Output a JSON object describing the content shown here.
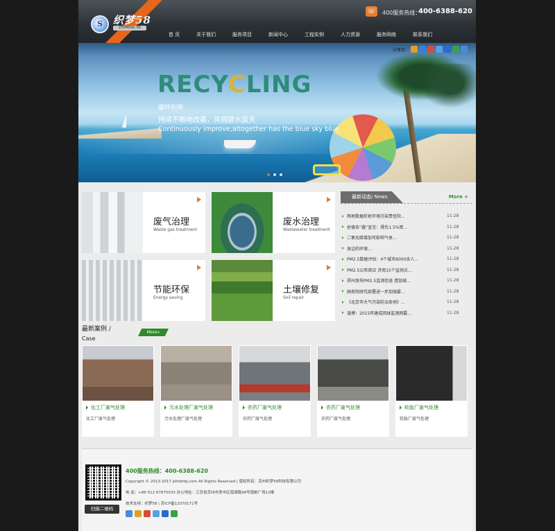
{
  "header": {
    "logo_text": "织梦58",
    "logo_badge": "S",
    "logo_sub": "ZHIMENG 58",
    "hotline_label": "400服务热线：",
    "hotline_number": "400-6388-620"
  },
  "nav": [
    "首 页",
    "关于我们",
    "服务项目",
    "新闻中心",
    "工程实例",
    "人力资源",
    "服务网络",
    "联系我们"
  ],
  "banner": {
    "share_label": "分享到:",
    "headline_a": "RECY",
    "headline_b": "C",
    "headline_c": "LING",
    "cn_line1": "循环利用",
    "cn_line2": "持续不断地改善，共拥碧水蓝天",
    "en_line": "Continuously improve,altogether has the blue sky blue"
  },
  "services": [
    {
      "title": "废气治理",
      "subtitle": "Waste gas treatment"
    },
    {
      "title": "废水治理",
      "subtitle": "Wastewater treatment"
    },
    {
      "title": "节能环保",
      "subtitle": "Energy saving"
    },
    {
      "title": "土壤修复",
      "subtitle": "Soil repair"
    }
  ],
  "news": {
    "title": "最新动态/ News",
    "more": "More +",
    "items": [
      {
        "title": "两地数据折射环境污染责任险...",
        "date": "11-28"
      },
      {
        "title": "佐德去“霾”宣言：得负1.5%密...",
        "date": "11-28"
      },
      {
        "title": "二氧化碳增加可影响气体...",
        "date": "11-28"
      },
      {
        "title": "身边的环保...",
        "date": "11-28"
      },
      {
        "title": "PM2.5数据评估：4个城市8000余人...",
        "date": "11-28"
      },
      {
        "title": "PM2.5公布首日 济南15个监测点...",
        "date": "11-28"
      },
      {
        "title": "郑州发布PM2.5监测信息 借加坡...",
        "date": "11-28"
      },
      {
        "title": "国务院研究部署进一步加强雾...",
        "date": "11-28"
      },
      {
        "title": "《北京市大气污染防治条例》...",
        "date": "11-28"
      },
      {
        "title": "淄博：2015年建成回球监测网要...",
        "date": "11-28"
      }
    ]
  },
  "cases": {
    "title": "最新案例 /",
    "title_en": "Case",
    "more": "More»",
    "items": [
      {
        "caption": "化工厂废气处理",
        "desc": "化工厂废气处理"
      },
      {
        "caption": "污水处理厂废气处理",
        "desc": "污水处理厂废气处理"
      },
      {
        "caption": "农药厂废气处理",
        "desc": "农药厂废气处理"
      },
      {
        "caption": "农药厂废气处理",
        "desc": "农药厂废气处理"
      },
      {
        "caption": "轮胎厂废气处理",
        "desc": "轮胎厂废气处理"
      }
    ]
  },
  "footer": {
    "hotline": "400服务热线：400-6388-620",
    "copyright": "Copyright © 2013-2017 Jsthbhbj.com All Rights Reserved | 版权所有：苏州织梦58科技有限公司",
    "contact": "电 话：+86 512 67875033 办公地址：江苏省苏州市吴中区南湖路98号南邮广场12楼",
    "support": "技术支持：织梦58 \\ 苏ICP备12070171号",
    "qr_button": "扫描二维码"
  },
  "colors": {
    "accent_orange": "#e9791f",
    "accent_green": "#2e8a2a",
    "share_icons": [
      "#e0a020",
      "#3b7dd8",
      "#d84a3b",
      "#5aa0e0",
      "#2a6bd1",
      "#3aa14a",
      "#4a8ad8"
    ]
  }
}
